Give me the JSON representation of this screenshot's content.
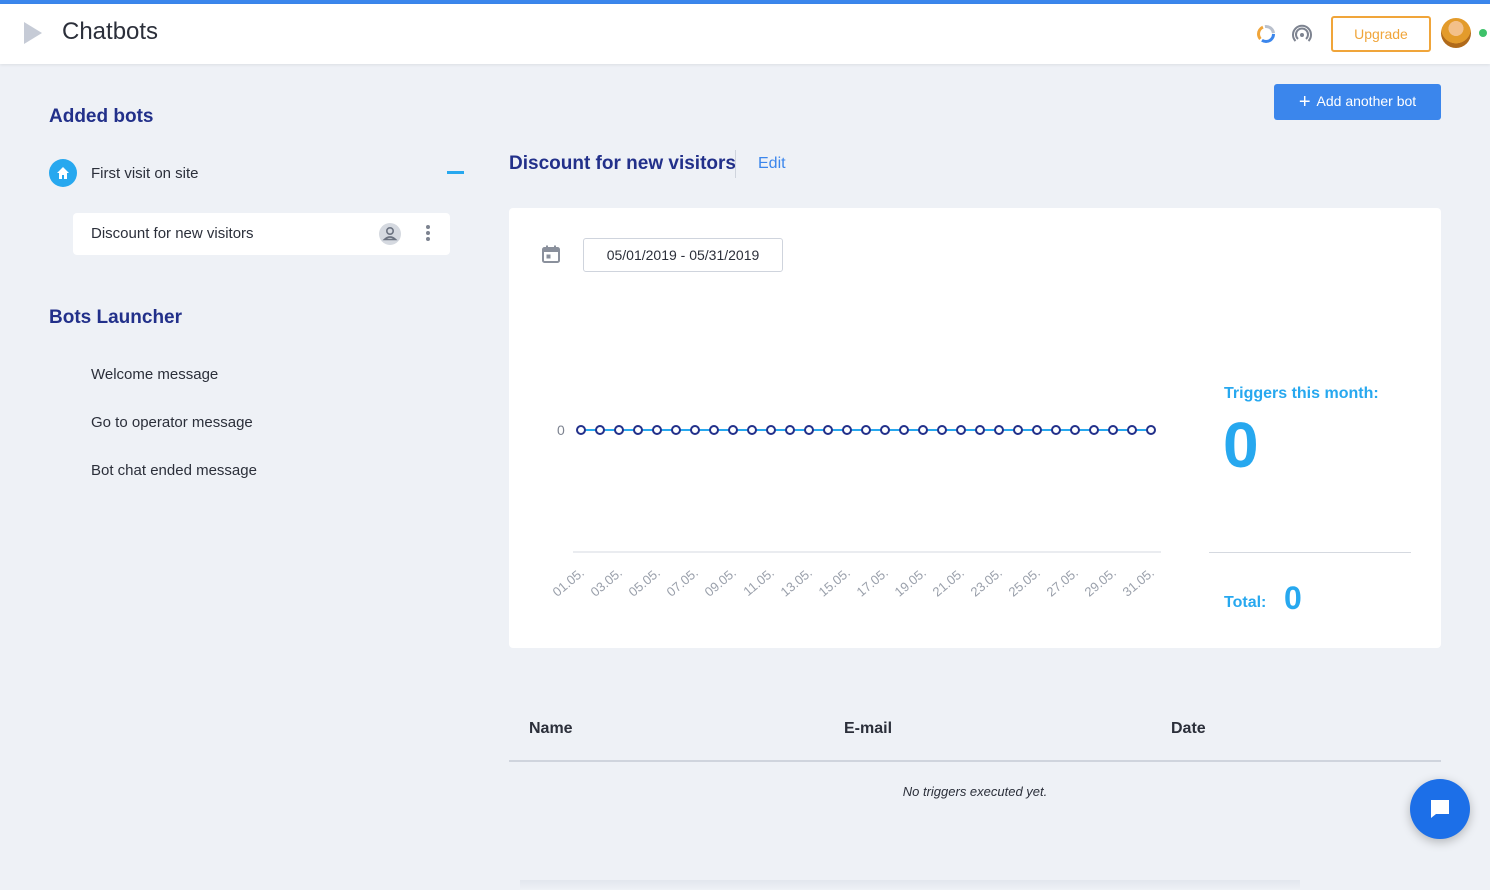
{
  "header": {
    "title": "Chatbots",
    "upgrade_label": "Upgrade"
  },
  "sidebar": {
    "added_bots_title": "Added bots",
    "bot_group": "First visit on site",
    "bot_item": "Discount for new visitors",
    "launcher_title": "Bots Launcher",
    "launcher_items": [
      "Welcome message",
      "Go to operator message",
      "Bot chat ended message"
    ]
  },
  "main": {
    "add_bot_label": "Add another bot",
    "bot_title": "Discount for new visitors",
    "edit_label": "Edit",
    "date_range": "05/01/2019 - 05/31/2019",
    "triggers_label": "Triggers this month:",
    "triggers_value": "0",
    "total_label": "Total:",
    "total_value": "0"
  },
  "chart_data": {
    "type": "line",
    "x": [
      "01.05.",
      "02.05.",
      "03.05.",
      "04.05.",
      "05.05.",
      "06.05.",
      "07.05.",
      "08.05.",
      "09.05.",
      "10.05.",
      "11.05.",
      "12.05.",
      "13.05.",
      "14.05.",
      "15.05.",
      "16.05.",
      "17.05.",
      "18.05.",
      "19.05.",
      "20.05.",
      "21.05.",
      "22.05.",
      "23.05.",
      "24.05.",
      "25.05.",
      "26.05.",
      "27.05.",
      "28.05.",
      "29.05.",
      "30.05.",
      "31.05."
    ],
    "tick_labels": [
      "01.05.",
      "03.05.",
      "05.05.",
      "07.05.",
      "09.05.",
      "11.05.",
      "13.05.",
      "15.05.",
      "17.05.",
      "19.05.",
      "21.05.",
      "23.05.",
      "25.05.",
      "27.05.",
      "29.05.",
      "31.05."
    ],
    "y_tick_labels": [
      "0"
    ],
    "series": [
      {
        "values": [
          0,
          0,
          0,
          0,
          0,
          0,
          0,
          0,
          0,
          0,
          0,
          0,
          0,
          0,
          0,
          0,
          0,
          0,
          0,
          0,
          0,
          0,
          0,
          0,
          0,
          0,
          0,
          0,
          0,
          0,
          0
        ]
      }
    ],
    "colors": {
      "line": "#27a8ef",
      "marker": "#22308a"
    }
  },
  "table": {
    "headers": [
      "Name",
      "E-mail",
      "Date"
    ],
    "empty_text": "No triggers executed yet."
  }
}
